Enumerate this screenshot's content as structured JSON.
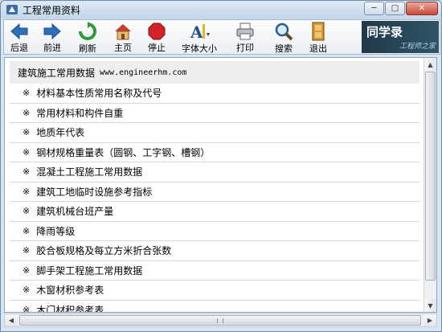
{
  "window": {
    "title": "工程常用资料"
  },
  "titlebar": {
    "minimize": "─",
    "maximize": "□",
    "close": "✕"
  },
  "toolbar": {
    "buttons": [
      {
        "label": "后退",
        "icon": "back-arrow-icon"
      },
      {
        "label": "前进",
        "icon": "forward-arrow-icon"
      },
      {
        "label": "刷新",
        "icon": "refresh-icon"
      },
      {
        "label": "主页",
        "icon": "home-icon"
      },
      {
        "label": "停止",
        "icon": "stop-icon"
      },
      {
        "label": "字体大小",
        "icon": "font-size-icon"
      },
      {
        "label": "打印",
        "icon": "printer-icon"
      },
      {
        "label": "搜索",
        "icon": "search-icon"
      },
      {
        "label": "退出",
        "icon": "exit-door-icon"
      }
    ],
    "brand": {
      "main": "同学录",
      "sub": "工程师之家"
    }
  },
  "content": {
    "header": {
      "title": "建筑施工常用数据",
      "site": "www.engineerhm.com"
    },
    "mark": "※",
    "items": [
      "材料基本性质常用名称及代号",
      "常用材料和构件自重",
      "地质年代表",
      "钢材规格重量表（圆钢、工字钢、槽钢）",
      "混凝土工程施工常用数据",
      "建筑工地临时设施参考指标",
      "建筑机械台班产量",
      "降雨等级",
      "胶合板规格及每立方米折合张数",
      "脚手架工程施工常用数据",
      "木窗材积参考表",
      "木门材积参考表"
    ]
  },
  "colors": {
    "title_bar": "#c3d6ea",
    "content_bg": "#ffffff",
    "header_row": "#eceef0",
    "brand_bg": "#1f3a4a"
  }
}
